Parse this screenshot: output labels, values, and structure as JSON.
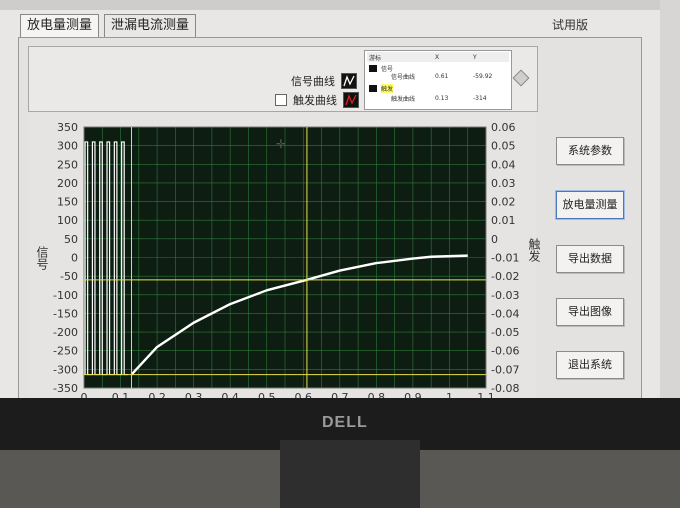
{
  "tabs": [
    {
      "label": "放电量测量",
      "active": true
    },
    {
      "label": "泄漏电流测量",
      "active": false
    }
  ],
  "trial_label": "试用版",
  "legend": {
    "signal_label": "信号曲线",
    "trigger_label": "触发曲线",
    "trigger_checked": false
  },
  "cursor_table": {
    "headers": [
      "游标",
      "X",
      "Y"
    ],
    "rows": [
      {
        "group": "信号",
        "name": "信号曲线",
        "x": "0.61",
        "y": "-59.92"
      },
      {
        "group": "触发",
        "name": "触发曲线",
        "x": "0.13",
        "y": "-314"
      }
    ]
  },
  "buttons": [
    {
      "label": "系统参数"
    },
    {
      "label": "放电量测量"
    },
    {
      "label": "导出数据"
    },
    {
      "label": "导出图像"
    },
    {
      "label": "退出系统"
    }
  ],
  "logo": "DELL",
  "chart_data": {
    "type": "line",
    "xlabel": "",
    "ylabel_left": "信号",
    "ylabel_right": "触发",
    "xlim": [
      0,
      1.1
    ],
    "ylim_left": [
      -350,
      350
    ],
    "ylim_right": [
      -0.08,
      0.06
    ],
    "x_ticks": [
      "0",
      "0.1",
      "0.2",
      "0.3",
      "0.4",
      "0.5",
      "0.6",
      "0.7",
      "0.8",
      "0.9",
      "1",
      "1.1"
    ],
    "y_ticks_left": [
      "350",
      "300",
      "250",
      "200",
      "150",
      "100",
      "50",
      "0",
      "-50",
      "-100",
      "-150",
      "-200",
      "-250",
      "-300",
      "-350"
    ],
    "y_ticks_right": [
      "0.06",
      "0.05",
      "0.04",
      "0.03",
      "0.02",
      "0.01",
      "0",
      "-0.01",
      "-0.02",
      "-0.03",
      "-0.04",
      "-0.05",
      "-0.06",
      "-0.07",
      "-0.08"
    ],
    "grid": true,
    "cursors": [
      {
        "x": 0.61,
        "y": -59.92
      },
      {
        "x": 0.13,
        "y": -314
      }
    ],
    "signal_series": {
      "name": "信号曲线",
      "square_wave": {
        "x_start": 0.0,
        "x_end": 0.12,
        "high": 310,
        "low": -314,
        "cycles": 6
      },
      "curve": [
        [
          0.13,
          -314
        ],
        [
          0.2,
          -240
        ],
        [
          0.3,
          -175
        ],
        [
          0.4,
          -125
        ],
        [
          0.5,
          -88
        ],
        [
          0.61,
          -59.92
        ],
        [
          0.7,
          -35
        ],
        [
          0.8,
          -15
        ],
        [
          0.9,
          -3
        ],
        [
          0.95,
          2
        ],
        [
          1.05,
          5
        ]
      ]
    }
  }
}
